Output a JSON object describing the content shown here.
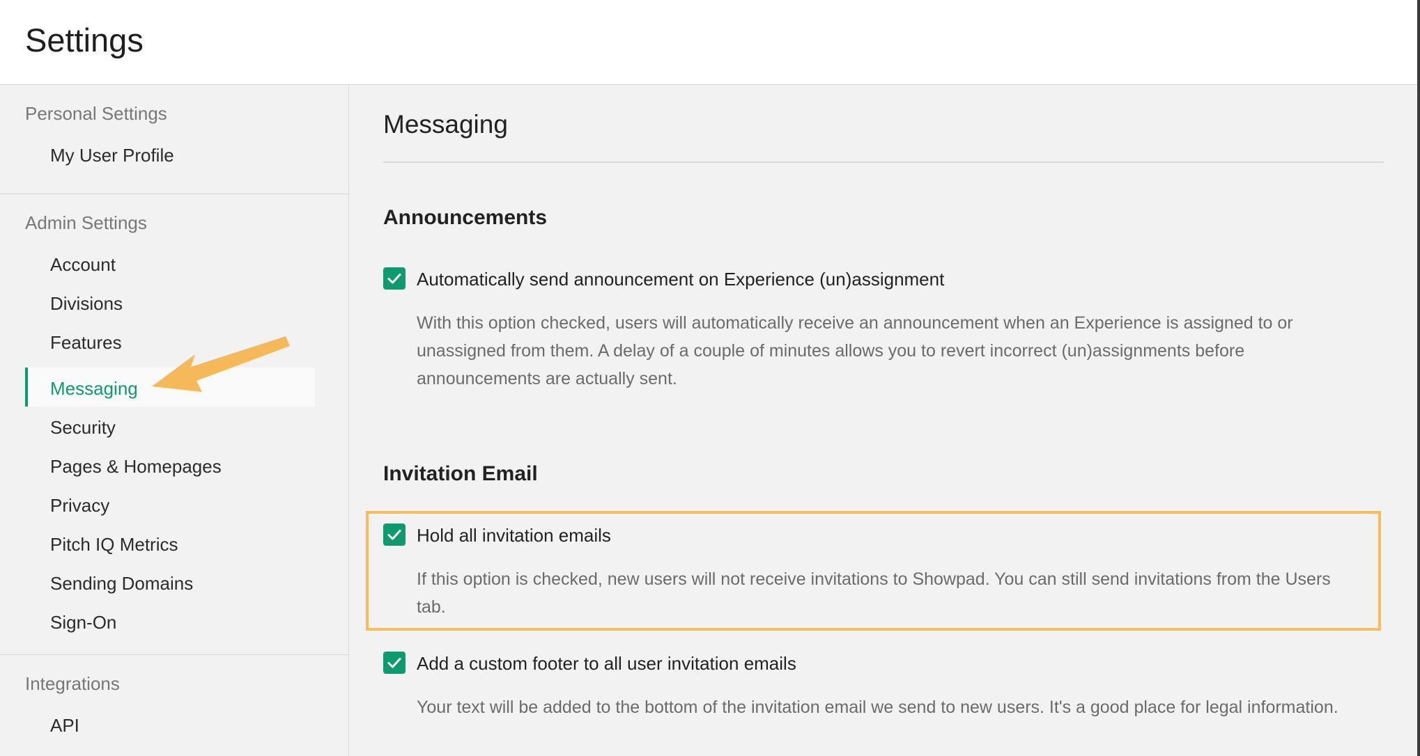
{
  "header": {
    "title": "Settings"
  },
  "sidebar": {
    "groups": [
      {
        "title": "Personal Settings",
        "items": [
          "My User Profile"
        ]
      },
      {
        "title": "Admin Settings",
        "items": [
          "Account",
          "Divisions",
          "Features",
          "Messaging",
          "Security",
          "Pages & Homepages",
          "Privacy",
          "Pitch IQ Metrics",
          "Sending Domains",
          "Sign-On"
        ]
      },
      {
        "title": "Integrations",
        "items": [
          "API"
        ]
      }
    ],
    "active_item": "Messaging"
  },
  "main": {
    "title": "Messaging",
    "sections": [
      {
        "title": "Announcements",
        "options": [
          {
            "label": "Automatically send announcement on Experience (un)assignment",
            "checked": true,
            "description": "With this option checked, users will automatically receive an announcement when an Experience is assigned to or unassigned from them. A delay of a couple of minutes allows you to revert incorrect (un)assignments before announcements are actually sent."
          }
        ]
      },
      {
        "title": "Invitation Email",
        "options": [
          {
            "label": "Hold all invitation emails",
            "checked": true,
            "description": "If this option is checked, new users will not receive invitations to Showpad. You can still send invitations from the Users tab."
          },
          {
            "label": "Add a custom footer to all user invitation emails",
            "checked": true,
            "description": "Your text will be added to the bottom of the invitation email we send to new users. It's a good place for legal information."
          }
        ]
      }
    ]
  },
  "colors": {
    "accent": "#0e9a6f",
    "highlight": "#f5bd5b",
    "arrow": "#f5b95a"
  },
  "annotations": {
    "arrow_icon": "arrow-pointer-icon",
    "highlight": "highlight-box"
  }
}
